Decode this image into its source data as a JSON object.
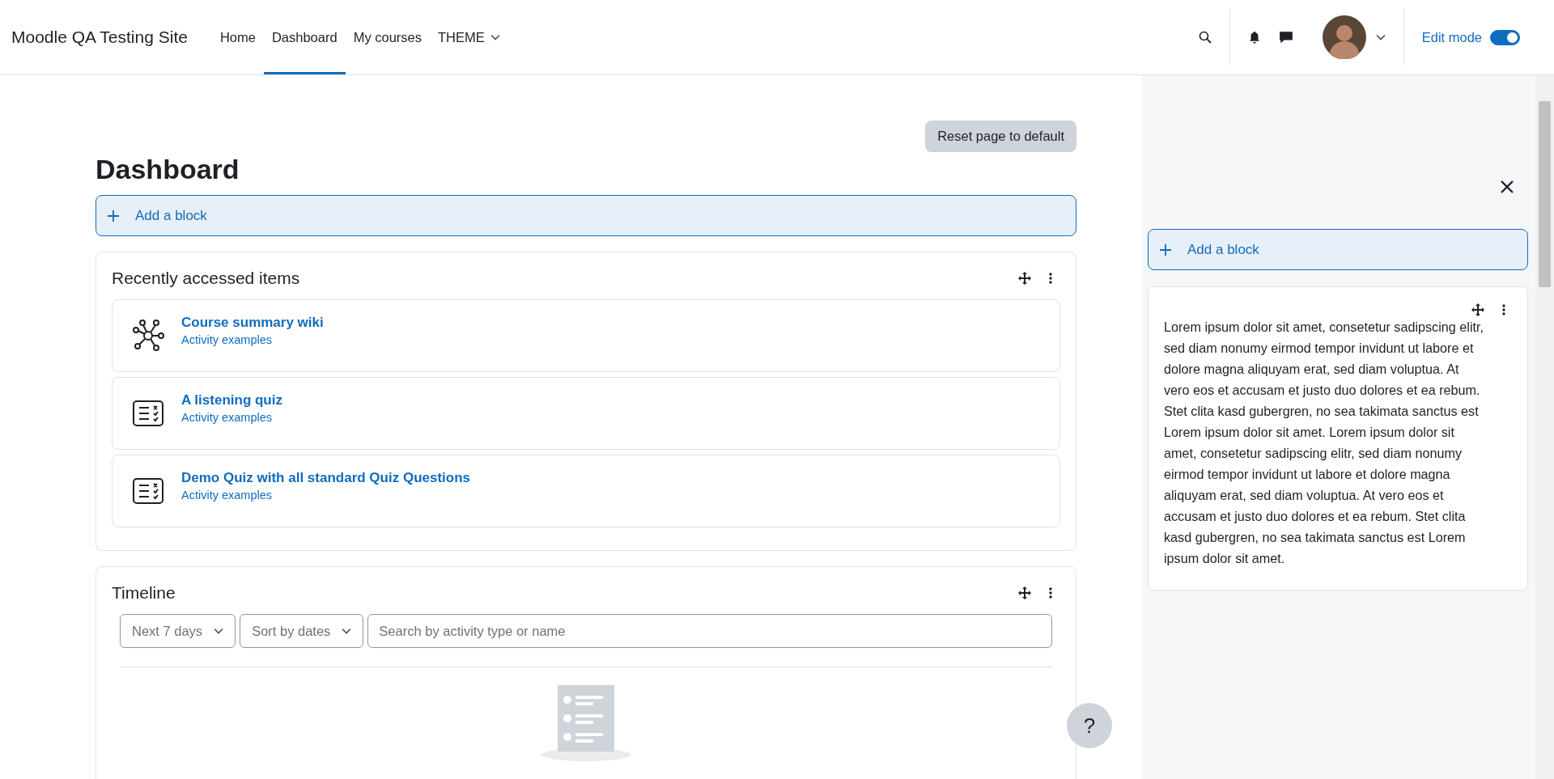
{
  "header": {
    "site_name": "Moodle QA Testing Site",
    "nav": [
      {
        "label": "Home",
        "selected": false,
        "kind": "link"
      },
      {
        "label": "Dashboard",
        "selected": true,
        "kind": "link"
      },
      {
        "label": "My courses",
        "selected": false,
        "kind": "link"
      },
      {
        "label": "THEME",
        "selected": false,
        "kind": "dropdown"
      }
    ],
    "edit_mode": {
      "label": "Edit mode",
      "on": true
    }
  },
  "main": {
    "reset_button": "Reset page to default",
    "title": "Dashboard",
    "add_block": "Add a block",
    "recent": {
      "title": "Recently accessed items",
      "items": [
        {
          "kind": "wiki",
          "name": "Course summary wiki",
          "course": "Activity examples"
        },
        {
          "kind": "quiz",
          "name": "A listening quiz",
          "course": "Activity examples"
        },
        {
          "kind": "quiz",
          "name": "Demo Quiz with all standard Quiz Questions",
          "course": "Activity examples"
        }
      ]
    },
    "timeline": {
      "title": "Timeline",
      "filters": [
        "Next 7 days",
        "Sort by dates"
      ],
      "search": {
        "placeholder": "Search by activity type or name"
      }
    }
  },
  "drawer": {
    "add_block": "Add a block",
    "text_block": "Lorem ipsum dolor sit amet, consetetur sadipscing elitr, sed diam nonumy eirmod tempor invidunt ut labore et dolore magna aliquyam erat, sed diam voluptua. At vero eos et accusam et justo duo dolores et ea rebum. Stet clita kasd gubergren, no sea takimata sanctus est Lorem ipsum dolor sit amet. Lorem ipsum dolor sit amet, consetetur sadipscing elitr, sed diam nonumy eirmod tempor invidunt ut labore et dolore magna aliquyam erat, sed diam voluptua. At vero eos et accusam et justo duo dolores et ea rebum. Stet clita kasd gubergren, no sea takimata sanctus est Lorem ipsum dolor sit amet."
  },
  "help_button": "?"
}
